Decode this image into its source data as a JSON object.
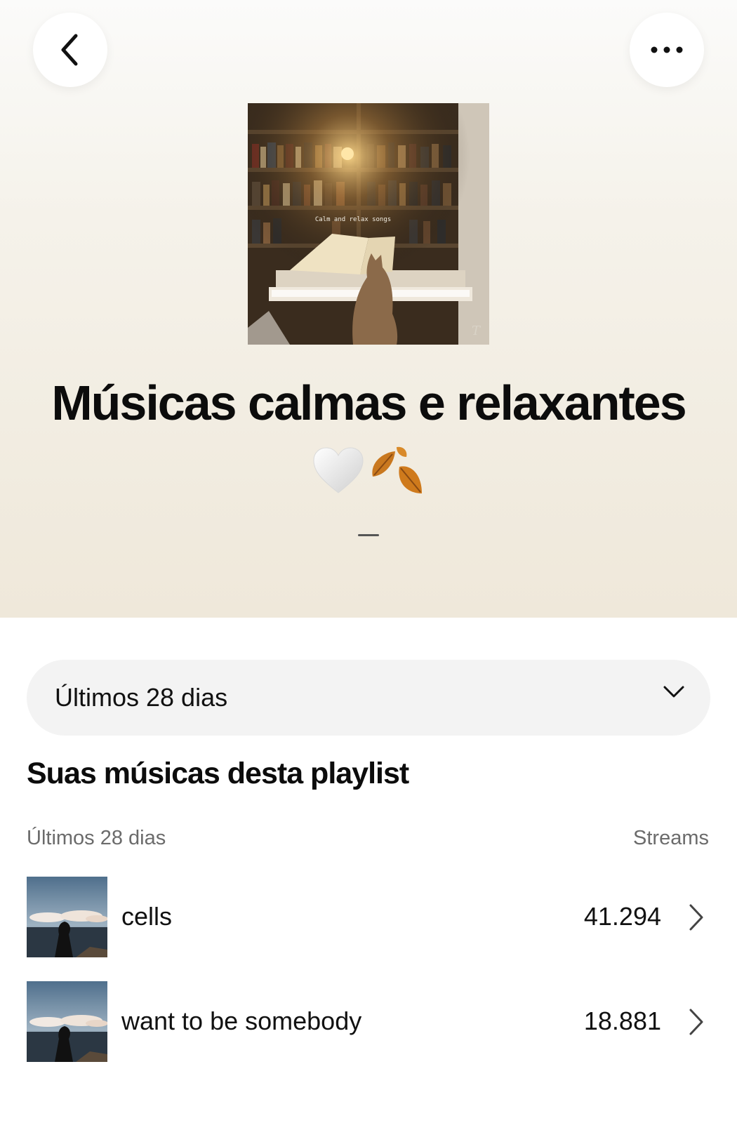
{
  "header": {
    "back_icon": "chevron-left-icon",
    "more_icon": "more-horizontal-icon",
    "cover_caption": "Calm and relax songs",
    "title": "Músicas calmas e relaxantes",
    "title_emoji": "🤍🍂",
    "subtitle": "—"
  },
  "period_select": {
    "value": "Últimos 28 dias",
    "icon": "chevron-down-icon"
  },
  "section": {
    "title": "Suas músicas desta playlist",
    "col_left": "Últimos 28 dias",
    "col_right": "Streams"
  },
  "tracks": [
    {
      "name": "cells",
      "streams": "41.294"
    },
    {
      "name": "want to be somebody",
      "streams": "18.881"
    }
  ]
}
